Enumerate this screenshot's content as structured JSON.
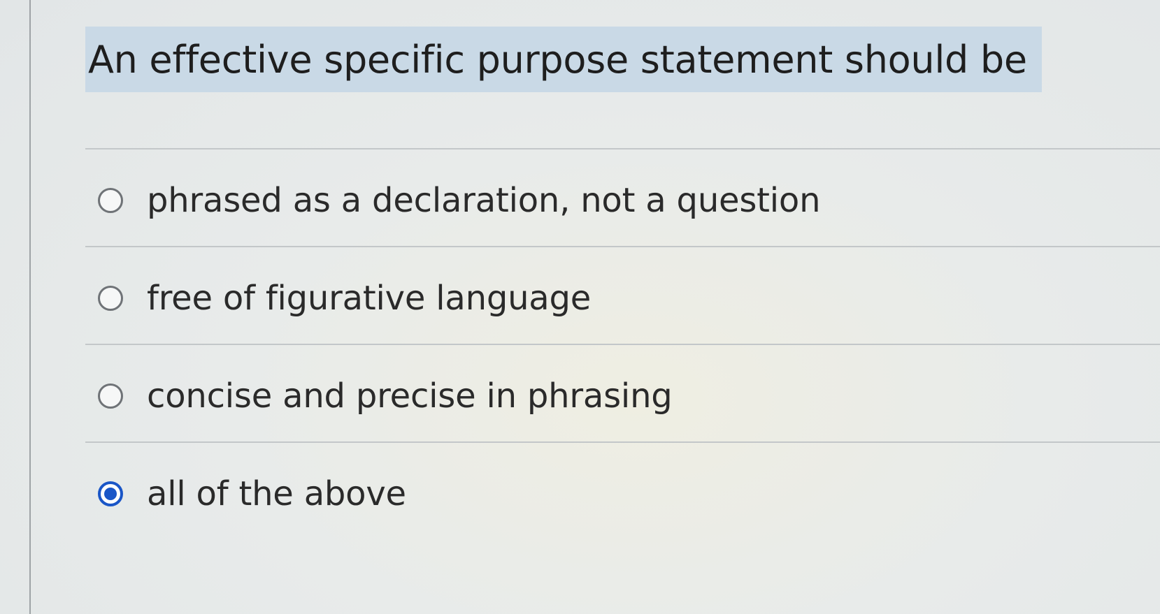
{
  "question": {
    "text": "An effective specific purpose statement should be"
  },
  "options": [
    {
      "label": "phrased as a declaration, not a question",
      "selected": false
    },
    {
      "label": "free of figurative language",
      "selected": false
    },
    {
      "label": "concise and precise in phrasing",
      "selected": false
    },
    {
      "label": "all of the above",
      "selected": true
    }
  ],
  "colors": {
    "question_highlight": "#c9d9e6",
    "radio_selected": "#1a56c7",
    "radio_border": "#6f7377",
    "divider": "#c3c7c9"
  },
  "icons": {
    "radio_unselected": "radio-empty-icon",
    "radio_selected": "radio-filled-icon"
  }
}
